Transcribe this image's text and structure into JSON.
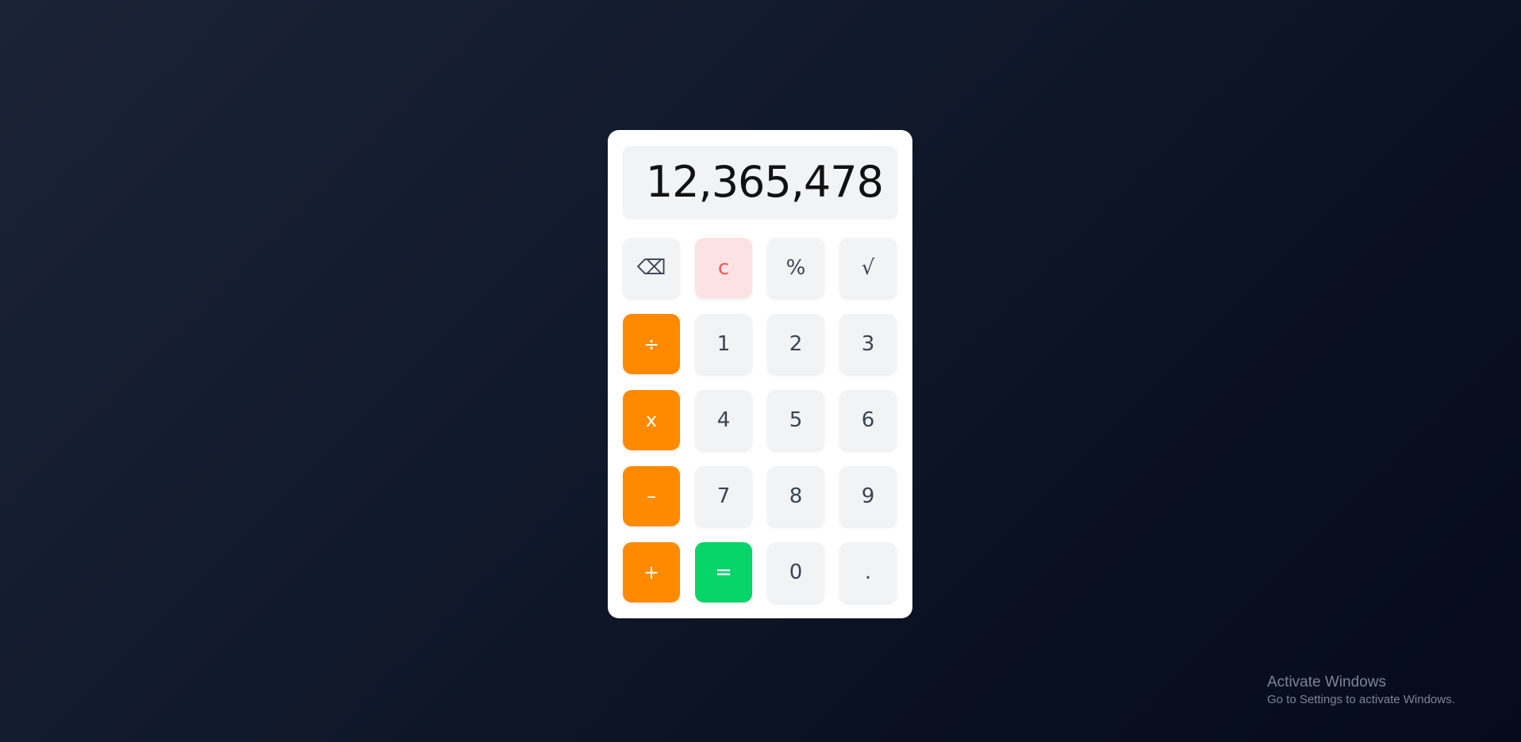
{
  "calculator": {
    "display": "12,365,478",
    "keys": [
      {
        "label": "⌫",
        "type": "function"
      },
      {
        "label": "c",
        "type": "clear"
      },
      {
        "label": "%",
        "type": "function"
      },
      {
        "label": "√",
        "type": "function"
      },
      {
        "label": "÷",
        "type": "operator"
      },
      {
        "label": "1",
        "type": "digit"
      },
      {
        "label": "2",
        "type": "digit"
      },
      {
        "label": "3",
        "type": "digit"
      },
      {
        "label": "x",
        "type": "operator"
      },
      {
        "label": "4",
        "type": "digit"
      },
      {
        "label": "5",
        "type": "digit"
      },
      {
        "label": "6",
        "type": "digit"
      },
      {
        "label": "–",
        "type": "operator"
      },
      {
        "label": "7",
        "type": "digit"
      },
      {
        "label": "8",
        "type": "digit"
      },
      {
        "label": "9",
        "type": "digit"
      },
      {
        "label": "+",
        "type": "operator"
      },
      {
        "label": "=",
        "type": "equals"
      },
      {
        "label": "0",
        "type": "digit"
      },
      {
        "label": ".",
        "type": "digit"
      }
    ]
  },
  "watermark": {
    "title": "Activate Windows",
    "subtitle": "Go to Settings to activate Windows."
  },
  "colors": {
    "operator": "#ff8a00",
    "equals": "#05d468",
    "clear_bg": "#fde2e3",
    "clear_text": "#f05656",
    "key_bg": "#f2f3f5"
  }
}
